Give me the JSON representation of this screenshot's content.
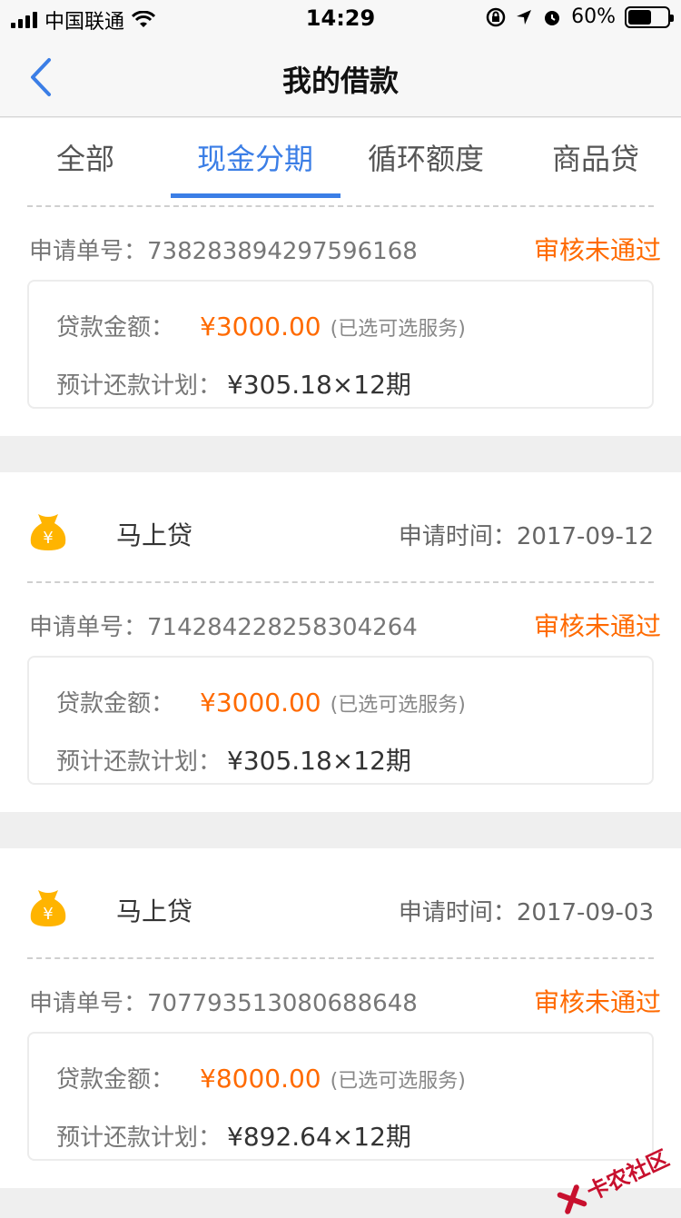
{
  "status_bar": {
    "carrier": "中国联通",
    "time": "14:29",
    "battery": "60%",
    "battery_level": 0.6
  },
  "nav": {
    "title": "我的借款"
  },
  "tabs": [
    {
      "label": "全部"
    },
    {
      "label": "现金分期"
    },
    {
      "label": "循环额度"
    },
    {
      "label": "商品贷"
    }
  ],
  "labels": {
    "apply_no": "申请单号：",
    "amount": "贷款金额：",
    "plan": "预计还款计划：",
    "optional": "(已选可选服务)",
    "apply_time": "申请时间："
  },
  "loans": [
    {
      "apply_no": "738283894297596168",
      "status": "审核未通过",
      "amount": "¥3000.00",
      "plan": "¥305.18×12期"
    },
    {
      "product": "马上贷",
      "apply_time": "2017-09-12",
      "apply_no": "714284228258304264",
      "status": "审核未通过",
      "amount": "¥3000.00",
      "plan": "¥305.18×12期"
    },
    {
      "product": "马上贷",
      "apply_time": "2017-09-03",
      "apply_no": "707793513080688648",
      "status": "审核未通过",
      "amount": "¥8000.00",
      "plan": "¥892.64×12期"
    }
  ],
  "watermark": {
    "text": "卡农社区"
  },
  "colors": {
    "accent": "#3b7ee6",
    "status": "#ff6a00",
    "icon": "#ffb400"
  }
}
